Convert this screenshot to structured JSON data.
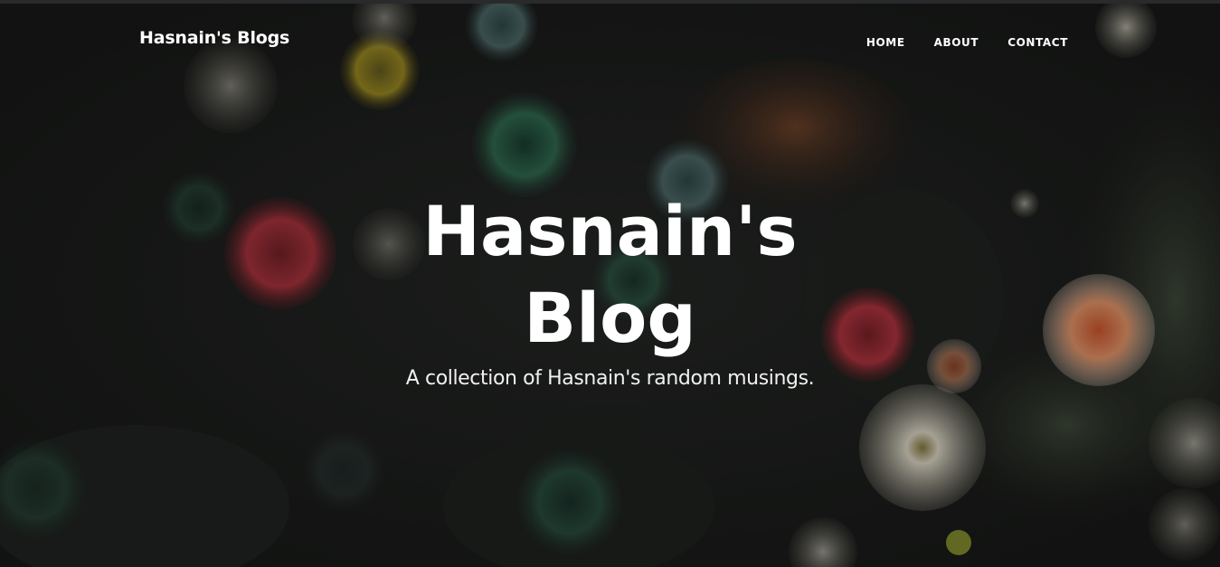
{
  "nav": {
    "brand": "Hasnain's Blogs",
    "links": [
      {
        "label": "HOME"
      },
      {
        "label": "ABOUT"
      },
      {
        "label": "CONTACT"
      }
    ]
  },
  "hero": {
    "title": "Hasnain's Blog",
    "subtitle": "A collection of Hasnain's random musings."
  }
}
